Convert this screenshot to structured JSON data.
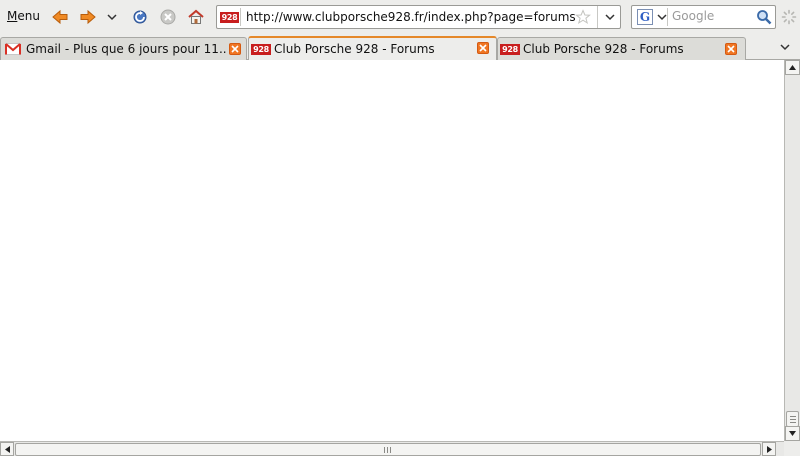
{
  "toolbar": {
    "menu_label": "Menu",
    "icons": [
      "back-icon",
      "forward-icon",
      "history-dropdown-icon",
      "reload-icon",
      "stop-icon",
      "home-icon"
    ]
  },
  "urlbar": {
    "site_badge": "928",
    "url": "http://www.clubporsche928.fr/index.php?page=forums"
  },
  "search": {
    "engine": "G",
    "placeholder": "Google",
    "value": ""
  },
  "tabs": [
    {
      "label": "Gmail - Plus que 6 jours pour 11...",
      "favicon": "gmail-icon",
      "active": false
    },
    {
      "label": "Club Porsche 928 - Forums",
      "favicon": "928",
      "active": true
    },
    {
      "label": "Club Porsche 928 - Forums",
      "favicon": "928",
      "active": false
    }
  ],
  "colors": {
    "accent": "#e5882a",
    "close": "#f07623",
    "badge": "#c81e1e",
    "content_bg": "#ffffff",
    "chrome_bg": "#ededeb"
  }
}
